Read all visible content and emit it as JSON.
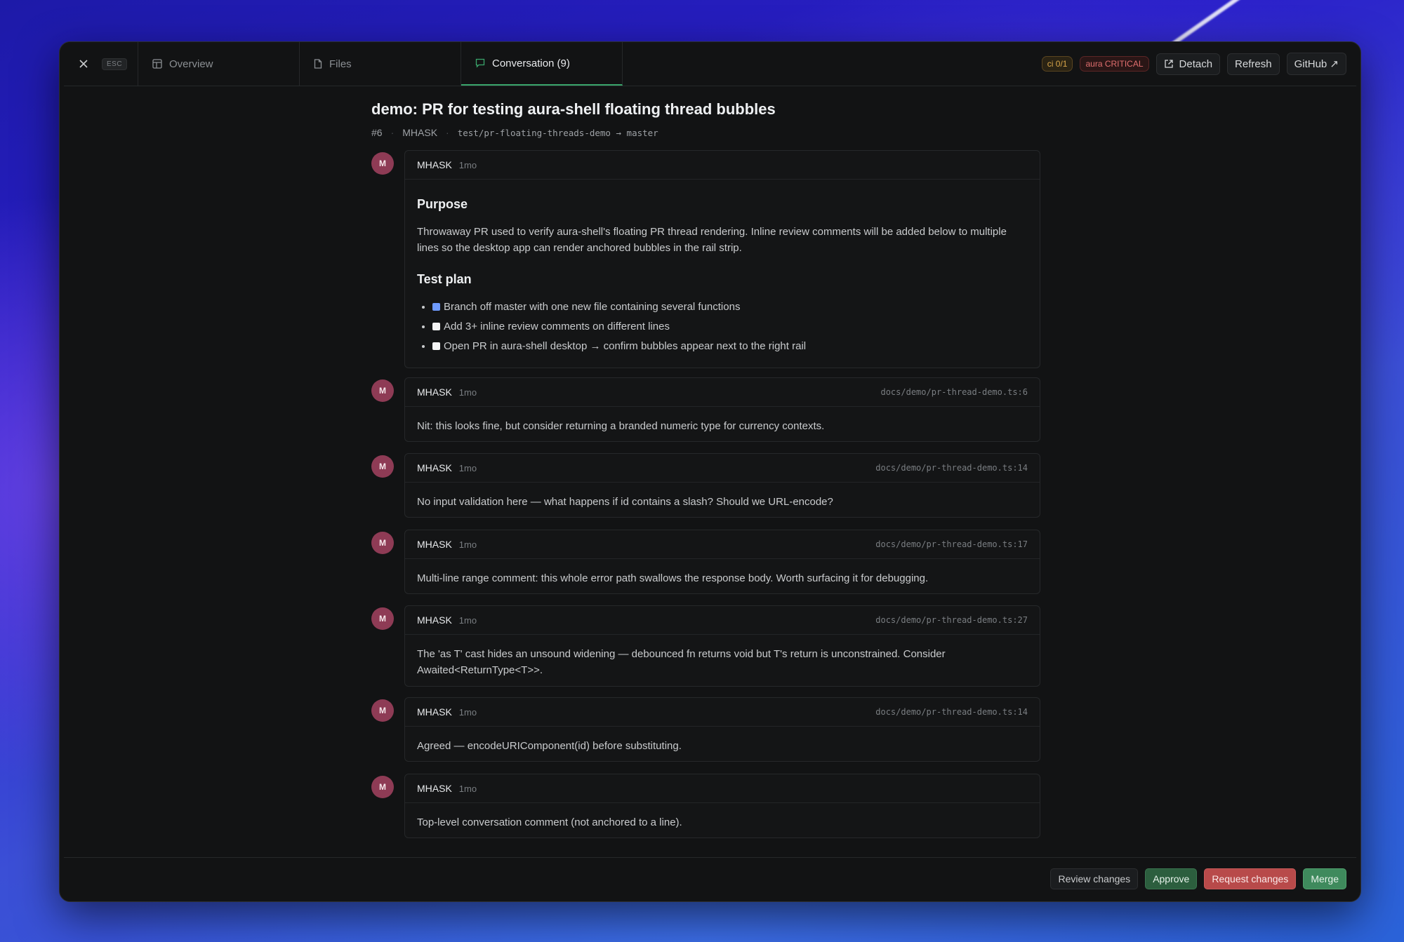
{
  "tabs": {
    "esc": "ESC",
    "overview": "Overview",
    "files": "Files",
    "conversation": "Conversation (9)"
  },
  "toolbar": {
    "ci_badge": "ci 0/1",
    "aura_badge": "aura CRITICAL",
    "detach": "Detach",
    "refresh": "Refresh",
    "github": "GitHub ↗"
  },
  "pr": {
    "title": "demo: PR for testing aura-shell floating thread bubbles",
    "number": "#6",
    "author": "MHASK",
    "branch": "test/pr-floating-threads-demo → master"
  },
  "description": {
    "author": "MHASK",
    "time": "1mo",
    "purpose_heading": "Purpose",
    "purpose_text": "Throwaway PR used to verify aura-shell's floating PR thread rendering. Inline review comments will be added below to multiple lines so the desktop app can render anchored bubbles in the rail strip.",
    "test_plan_heading": "Test plan",
    "test_plan": [
      {
        "text": "Branch off master with one new file containing several functions",
        "checked": true
      },
      {
        "text": "Add 3+ inline review comments on different lines",
        "checked": false
      },
      {
        "text": "Open PR in aura-shell desktop → confirm bubbles appear next to the right rail",
        "checked": false
      }
    ]
  },
  "comments": [
    {
      "avatar": "M",
      "author": "MHASK",
      "time": "1mo",
      "path": "docs/demo/pr-thread-demo.ts:6",
      "body": "Nit: this looks fine, but consider returning a branded numeric type for currency contexts."
    },
    {
      "avatar": "M",
      "author": "MHASK",
      "time": "1mo",
      "path": "docs/demo/pr-thread-demo.ts:14",
      "body": "No input validation here — what happens if id contains a slash? Should we URL-encode?"
    },
    {
      "avatar": "M",
      "author": "MHASK",
      "time": "1mo",
      "path": "docs/demo/pr-thread-demo.ts:17",
      "body": "Multi-line range comment: this whole error path swallows the response body. Worth surfacing it for debugging."
    },
    {
      "avatar": "M",
      "author": "MHASK",
      "time": "1mo",
      "path": "docs/demo/pr-thread-demo.ts:27",
      "body": "The 'as T' cast hides an unsound widening — debounced fn returns void but T's return is unconstrained. Consider Awaited<ReturnType<T>>."
    },
    {
      "avatar": "M",
      "author": "MHASK",
      "time": "1mo",
      "path": "docs/demo/pr-thread-demo.ts:14",
      "body": "Agreed — encodeURIComponent(id) before substituting."
    },
    {
      "avatar": "M",
      "author": "MHASK",
      "time": "1mo",
      "path": "",
      "body": "Top-level conversation comment (not anchored to a line)."
    }
  ],
  "footer": {
    "review_changes": "Review changes",
    "approve": "Approve",
    "request_changes": "Request changes",
    "merge": "Merge"
  },
  "colors": {
    "window_bg": "#121314",
    "active_tab_accent": "#3aa56b",
    "avatar": "#8e3b55",
    "approve": "#2c5e3e",
    "request_changes": "#b84a4a",
    "merge": "#3f8a5d"
  }
}
